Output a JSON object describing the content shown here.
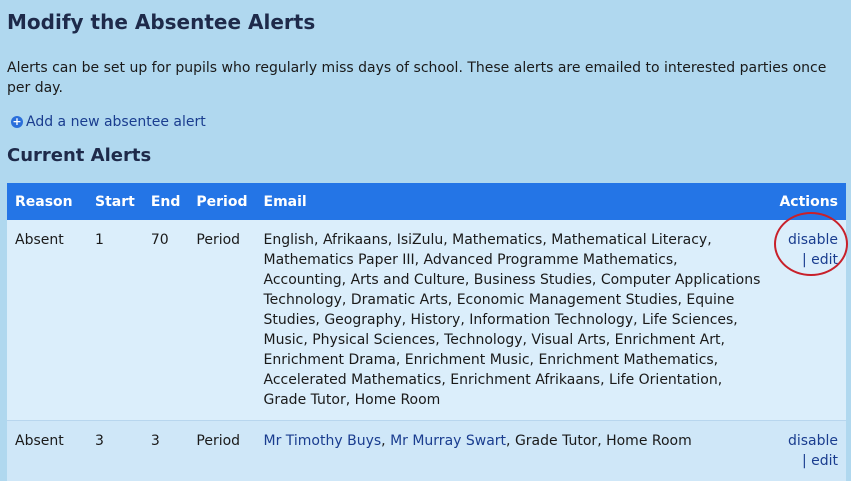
{
  "page": {
    "title": "Modify the Absentee Alerts",
    "description": "Alerts can be set up for pupils who regularly miss days of school. These alerts are emailed to interested parties once per day.",
    "add_link": "Add a new absentee alert",
    "section_title": "Current Alerts"
  },
  "table": {
    "headers": {
      "reason": "Reason",
      "start": "Start",
      "end": "End",
      "period": "Period",
      "email": "Email",
      "actions": "Actions"
    },
    "rows": [
      {
        "reason": "Absent",
        "start": "1",
        "end": "70",
        "period": "Period",
        "email": "English, Afrikaans, IsiZulu, Mathematics, Mathematical Literacy, Mathematics Paper III, Advanced Programme Mathematics, Accounting, Arts and Culture, Business Studies, Computer Applications Technology, Dramatic Arts, Economic Management Studies, Equine Studies, Geography, History, Information Technology, Life Sciences, Music, Physical Sciences, Technology, Visual Arts, Enrichment Art, Enrichment Drama, Enrichment Music, Enrichment Mathematics, Accelerated Mathematics, Enrichment Afrikaans, Life Orientation, Grade Tutor, Home Room",
        "disable": "disable",
        "separator": "|",
        "edit": "edit"
      },
      {
        "reason": "Absent",
        "start": "3",
        "end": "3",
        "period": "Period",
        "email_link1": "Mr Timothy Buys",
        "email_sep": ",",
        "email_link2": "Mr Murray Swart",
        "email_rest": ", Grade Tutor, Home Room",
        "disable": "disable",
        "separator": "|",
        "edit": "edit"
      }
    ]
  },
  "icons": {
    "add": "plus-circle-icon"
  },
  "colors": {
    "background": "#b0d8ef",
    "header": "#2475e6",
    "link": "#1a3d8f",
    "highlight_circle": "#c8202a"
  }
}
